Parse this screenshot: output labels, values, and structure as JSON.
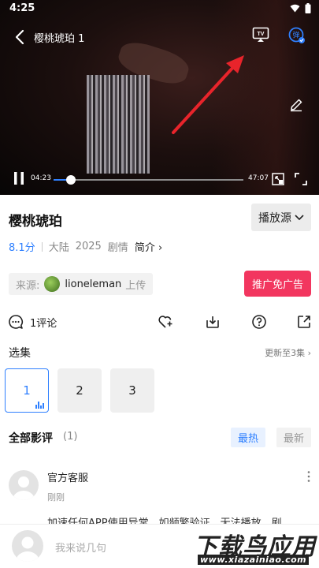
{
  "status_bar": {
    "time": "4:25"
  },
  "player": {
    "title": "樱桃琥珀 1",
    "current_time": "04:23",
    "duration": "47:07",
    "progress": 0.093
  },
  "movie": {
    "title": "樱桃琥珀",
    "source_label": "播放源",
    "score": "8.1分",
    "region": "大陆",
    "year": "2025",
    "genre": "剧情",
    "intro_label": "简介"
  },
  "uploader": {
    "label": "来源:",
    "name": "lioneleman",
    "action": "上传"
  },
  "promo_button": "推广免广告",
  "actions": {
    "comment_count": "1评论"
  },
  "episodes": {
    "heading": "选集",
    "update_note": "更新至3集",
    "items": [
      "1",
      "2",
      "3"
    ]
  },
  "reviews": {
    "heading": "全部影评",
    "count": "(1)",
    "sort_hot": "最热",
    "sort_latest": "最新",
    "items": [
      {
        "user": "官方客服",
        "time": "刚刚",
        "text": "加速任何APP使用异常，如频繁验证、无法播放、剧"
      }
    ]
  },
  "comment_input": {
    "placeholder": "我来说几句"
  },
  "watermark": {
    "text": "下载鸟应用",
    "url": "www.xiazainiao.com"
  },
  "colors": {
    "accent": "#2f80ff",
    "promo": "#f2365f",
    "arrow": "#e8242b"
  }
}
